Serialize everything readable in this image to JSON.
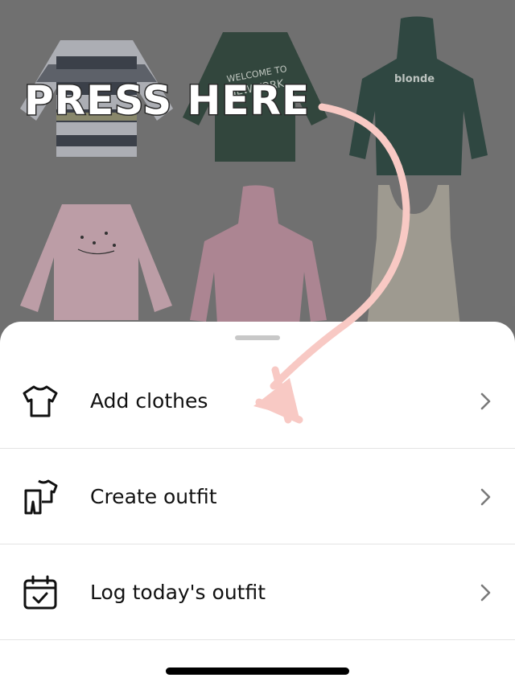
{
  "overlay": {
    "callout": "PRESS HERE"
  },
  "closet": {
    "items": [
      {
        "name": "striped-sweater",
        "color": "#b6b8bf"
      },
      {
        "name": "green-sweatshirt",
        "color": "#33493f",
        "print": "WELCOME TO NEW YORK"
      },
      {
        "name": "green-hoodie",
        "color": "#314b45",
        "print": "blonde"
      },
      {
        "name": "pink-sweatshirt",
        "color": "#c9a9b2"
      },
      {
        "name": "pink-hoodie",
        "color": "#b98f9e"
      },
      {
        "name": "tank-dress",
        "color": "#a8a39a"
      }
    ]
  },
  "sheet": {
    "items": [
      {
        "label": "Add clothes",
        "icon": "shirt-icon"
      },
      {
        "label": "Create outfit",
        "icon": "outfit-icon"
      },
      {
        "label": "Log today's outfit",
        "icon": "calendar-check-icon"
      }
    ]
  },
  "colors": {
    "arrow": "#f8c9c4",
    "sheet_bg": "#ffffff",
    "text": "#111111"
  }
}
